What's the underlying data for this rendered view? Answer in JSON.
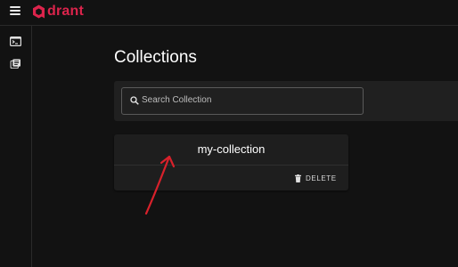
{
  "app": {
    "logo_text": "drant",
    "brand_color": "#dc244c"
  },
  "header": {
    "menu_icon": "hamburger-menu-icon"
  },
  "sidebar": {
    "items": [
      {
        "icon": "terminal-console-icon"
      },
      {
        "icon": "collections-library-icon"
      }
    ]
  },
  "main": {
    "title": "Collections",
    "search": {
      "placeholder": "Search Collection",
      "value": ""
    },
    "collections": [
      {
        "name": "my-collection",
        "delete_label": "DELETE"
      }
    ]
  },
  "annotation": {
    "type": "red-arrow",
    "color": "#d8212b",
    "points_to": "my-collection"
  }
}
